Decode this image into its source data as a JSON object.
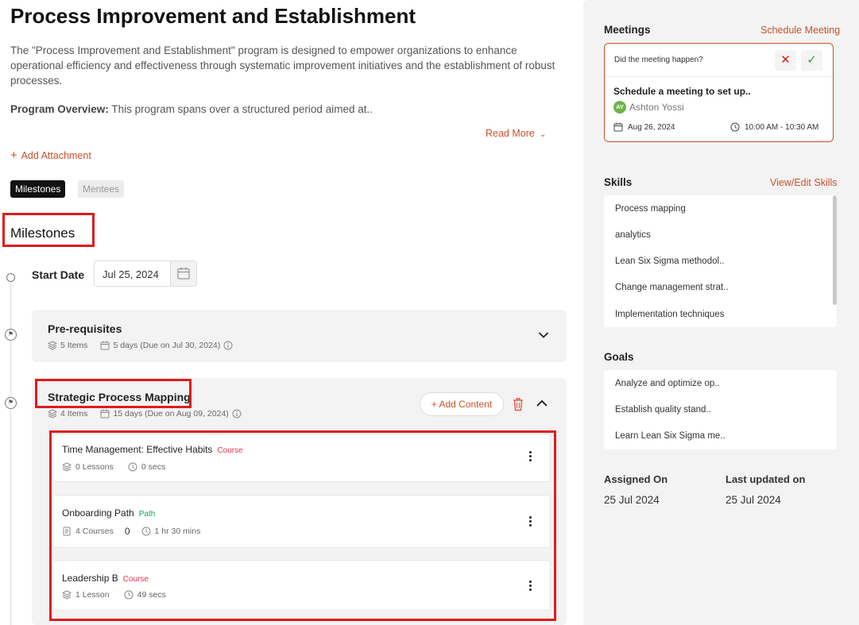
{
  "program": {
    "title": "Process Improvement and Establishment",
    "description": "The \"Process Improvement and Establishment\" program is designed to empower organizations to enhance operational efficiency and effectiveness through systematic improvement initiatives and the establishment of robust processes.",
    "overview_label": "Program Overview:",
    "overview_text": " This program spans over a structured period aimed at..",
    "read_more": "Read More",
    "add_attachment": "Add Attachment"
  },
  "tabs": [
    "Milestones",
    "Mentees"
  ],
  "milestones_section": {
    "title": "Milestones",
    "start_date_label": "Start Date",
    "start_date_value": "Jul 25, 2024",
    "milestones": [
      {
        "title": "Pre-requisites",
        "items": "5 Items",
        "duration": "5 days (Due on Jul 30, 2024)",
        "expanded": false
      },
      {
        "title": "Strategic Process Mapping",
        "items": "4 Items",
        "duration": "15 days (Due on Aug 09, 2024)",
        "expanded": true,
        "add_content": "+ Add Content",
        "content": [
          {
            "title": "Time Management: Effective Habits",
            "type": "Course",
            "meta1": "0 Lessons",
            "meta2": "0 secs"
          },
          {
            "title": "Onboarding Path",
            "type": "Path",
            "meta1": "4 Courses",
            "meta_extra": "0",
            "meta2": "1 hr 30 mins"
          },
          {
            "title": "Leadership B",
            "type": "Course",
            "meta1": "1 Lesson",
            "meta2": "49 secs"
          }
        ]
      }
    ]
  },
  "sidebar": {
    "meetings": {
      "heading": "Meetings",
      "schedule_link": "Schedule Meeting",
      "question": "Did the meeting happen?",
      "title": "Schedule a meeting to set up..",
      "avatar_initials": "AY",
      "person": "Ashton Yossi",
      "date": "Aug 26, 2024",
      "time": "10:00 AM - 10:30 AM"
    },
    "skills": {
      "heading": "Skills",
      "link": "View/Edit Skills",
      "items": [
        "Process mapping",
        "analytics",
        "Lean Six Sigma methodol..",
        "Change management strat..",
        "Implementation techniques"
      ]
    },
    "goals": {
      "heading": "Goals",
      "items": [
        "Analyze and optimize op..",
        "Establish quality stand..",
        "Learn Lean Six Sigma me.."
      ]
    },
    "assigned_on_label": "Assigned On",
    "assigned_on": "25 Jul 2024",
    "last_updated_label": "Last updated on",
    "last_updated": "25 Jul 2024"
  },
  "colors": {
    "accent": "#c9512c",
    "highlight_box": "#e01b1b",
    "course_tag": "#e0344b",
    "path_tag": "#1e9e5a"
  }
}
